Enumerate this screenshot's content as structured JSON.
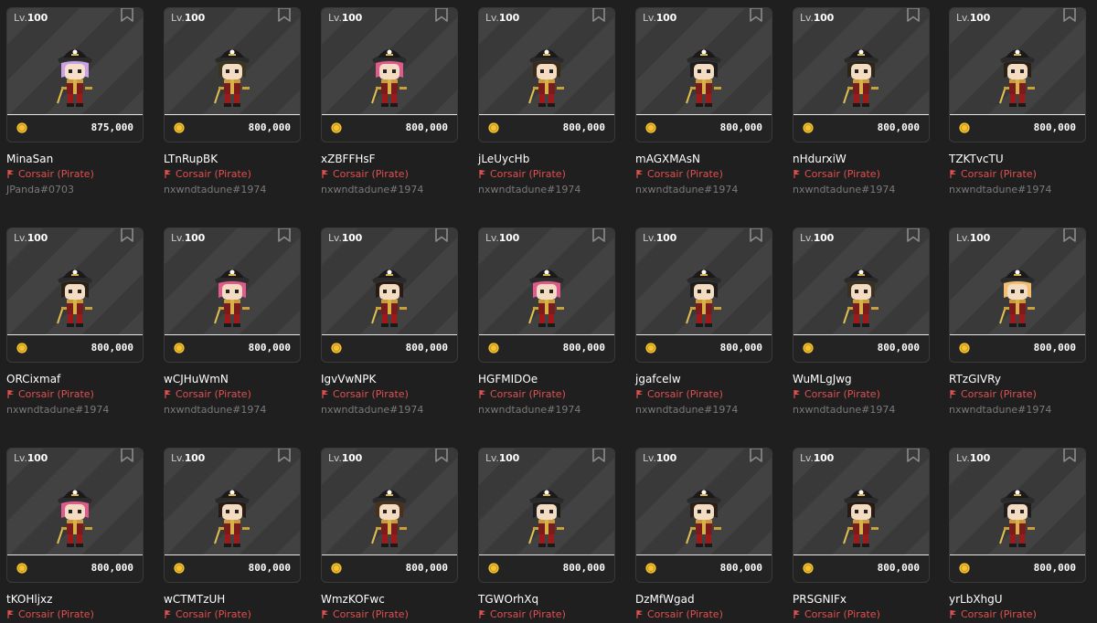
{
  "level_prefix": "Lv.",
  "job_icon": "pirate-flag-icon",
  "coin_icon": "meso-coin-icon",
  "bookmark_icon": "bookmark-icon",
  "colors": {
    "background": "#1f1f1f",
    "job_text": "#e05050",
    "owner_text": "#7a7a7a",
    "coin": "#f2c230"
  },
  "listings": [
    {
      "level": "100",
      "price": "875,000",
      "name": "MinaSan",
      "job": "Corsair (Pirate)",
      "owner": "JPanda#0703",
      "hair": "#c9a3e8",
      "skin": "#f7dfc9"
    },
    {
      "level": "100",
      "price": "800,000",
      "name": "LTnRupBK",
      "job": "Corsair (Pirate)",
      "owner": "nxwndtadune#1974",
      "hair": "#3b3520",
      "skin": "#f3dcc2"
    },
    {
      "level": "100",
      "price": "800,000",
      "name": "xZBFFHsF",
      "job": "Corsair (Pirate)",
      "owner": "nxwndtadune#1974",
      "hair": "#e05a8e",
      "skin": "#f3dcc2"
    },
    {
      "level": "100",
      "price": "800,000",
      "name": "jLeUycHb",
      "job": "Corsair (Pirate)",
      "owner": "nxwndtadune#1974",
      "hair": "#3a2a1a",
      "skin": "#f3dcc2"
    },
    {
      "level": "100",
      "price": "800,000",
      "name": "mAGXMAsN",
      "job": "Corsair (Pirate)",
      "owner": "nxwndtadune#1974",
      "hair": "#1e1e1e",
      "skin": "#f3dcc2"
    },
    {
      "level": "100",
      "price": "800,000",
      "name": "nHdurxiW",
      "job": "Corsair (Pirate)",
      "owner": "nxwndtadune#1974",
      "hair": "#2c2618",
      "skin": "#f3dcc2"
    },
    {
      "level": "100",
      "price": "800,000",
      "name": "TZKTvcTU",
      "job": "Corsair (Pirate)",
      "owner": "nxwndtadune#1974",
      "hair": "#2a2015",
      "skin": "#f3dcc2"
    },
    {
      "level": "100",
      "price": "800,000",
      "name": "ORCixmaf",
      "job": "Corsair (Pirate)",
      "owner": "nxwndtadune#1974",
      "hair": "#2a2015",
      "skin": "#f3dcc2"
    },
    {
      "level": "100",
      "price": "800,000",
      "name": "wCJHuWmN",
      "job": "Corsair (Pirate)",
      "owner": "nxwndtadune#1974",
      "hair": "#e05a8e",
      "skin": "#f3dcc2"
    },
    {
      "level": "100",
      "price": "800,000",
      "name": "IgvVwNPK",
      "job": "Corsair (Pirate)",
      "owner": "nxwndtadune#1974",
      "hair": "#2a1a14",
      "skin": "#f3dcc2"
    },
    {
      "level": "100",
      "price": "800,000",
      "name": "HGFMIDOe",
      "job": "Corsair (Pirate)",
      "owner": "nxwndtadune#1974",
      "hair": "#e05a8e",
      "skin": "#f3dcc2"
    },
    {
      "level": "100",
      "price": "800,000",
      "name": "jgafcelw",
      "job": "Corsair (Pirate)",
      "owner": "nxwndtadune#1974",
      "hair": "#1e1e1e",
      "skin": "#f3dcc2"
    },
    {
      "level": "100",
      "price": "800,000",
      "name": "WuMLgJwg",
      "job": "Corsair (Pirate)",
      "owner": "nxwndtadune#1974",
      "hair": "#3a3020",
      "skin": "#f3dcc2"
    },
    {
      "level": "100",
      "price": "800,000",
      "name": "RTzGIVRy",
      "job": "Corsair (Pirate)",
      "owner": "nxwndtadune#1974",
      "hair": "#f0c070",
      "skin": "#f3dcc2"
    },
    {
      "level": "100",
      "price": "800,000",
      "name": "tKOHljxz",
      "job": "Corsair (Pirate)",
      "owner": "",
      "hair": "#e05a8e",
      "skin": "#f3dcc2"
    },
    {
      "level": "100",
      "price": "800,000",
      "name": "wCTMTzUH",
      "job": "Corsair (Pirate)",
      "owner": "",
      "hair": "#2a1a14",
      "skin": "#f3dcc2"
    },
    {
      "level": "100",
      "price": "800,000",
      "name": "WmzKOFwc",
      "job": "Corsair (Pirate)",
      "owner": "",
      "hair": "#4a3018",
      "skin": "#f3dcc2"
    },
    {
      "level": "100",
      "price": "800,000",
      "name": "TGWOrhXq",
      "job": "Corsair (Pirate)",
      "owner": "",
      "hair": "#1e1e1e",
      "skin": "#f3dcc2"
    },
    {
      "level": "100",
      "price": "800,000",
      "name": "DzMfWgad",
      "job": "Corsair (Pirate)",
      "owner": "",
      "hair": "#2a2015",
      "skin": "#f3dcc2"
    },
    {
      "level": "100",
      "price": "800,000",
      "name": "PRSGNIFx",
      "job": "Corsair (Pirate)",
      "owner": "",
      "hair": "#2a1a14",
      "skin": "#f3dcc2"
    },
    {
      "level": "100",
      "price": "800,000",
      "name": "yrLbXhgU",
      "job": "Corsair (Pirate)",
      "owner": "",
      "hair": "#1e1e1e",
      "skin": "#f3dcc2"
    }
  ]
}
